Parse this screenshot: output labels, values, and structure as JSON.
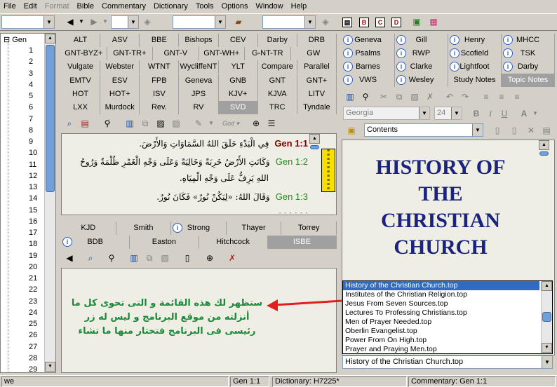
{
  "menu": [
    "File",
    "Edit",
    "Format",
    "Bible",
    "Commentary",
    "Dictionary",
    "Tools",
    "Options",
    "Window",
    "Help"
  ],
  "tree": {
    "root": "Gen",
    "chapters": [
      "1",
      "2",
      "3",
      "4",
      "5",
      "6",
      "7",
      "8",
      "9",
      "10",
      "11",
      "12",
      "13",
      "14",
      "15",
      "16",
      "17",
      "18",
      "19",
      "20",
      "21",
      "22",
      "23",
      "24",
      "25",
      "26",
      "27",
      "28",
      "29"
    ]
  },
  "bible_tabs": [
    [
      "ALT",
      "ASV",
      "BBE",
      "Bishops",
      "CEV",
      "Darby",
      "DRB"
    ],
    [
      "GNT-BYZ+",
      "GNT-TR+",
      "GNT-V",
      "GNT-WH+",
      "G-NT-TR (Steph)+",
      "GW"
    ],
    [
      "Vulgate",
      "Webster",
      "WTNT",
      "WycliffeNT",
      "YLT",
      "Compare",
      "Parallel"
    ],
    [
      "EMTV",
      "ESV",
      "FPB",
      "Geneva",
      "GNB",
      "GNT",
      "GNT+"
    ],
    [
      "HOT",
      "HOT+",
      "ISV",
      "JPS",
      "KJV+",
      "KJVA",
      "LITV"
    ],
    [
      "LXX",
      "Murdock",
      "Rev. Webster+",
      "RV",
      "SVD",
      "TRC",
      "Tyndale"
    ]
  ],
  "bible_active": "SVD",
  "bible_verses": [
    {
      "ref": "Gen 1:1",
      "text": "فِي الْبَدْءِ خَلَقَ اللهُ السَّمَاوَاتِ وَالأَرْضَ."
    },
    {
      "ref": "Gen 1:2",
      "text": "وَكَانَتِ الأَرْضُ خَرِبَةً وَخَالِيَةً وَعَلَى وَجْهِ الْغَمْرِ ظُلْمَةٌ وَرُوحُ"
    },
    {
      "ref": "",
      "text": "اللهِ يَرِفُّ عَلَى وَجْهِ الْمِيَاهِ."
    },
    {
      "ref": "Gen 1:3",
      "text": "وَقَالَ اللهُ: «لِيَكُنْ نُورٌ» فَكَانَ نُورٌ."
    }
  ],
  "dict_tabs": [
    [
      "KJD",
      "Smith",
      "Strong",
      "Thayer",
      "Torrey"
    ],
    [
      "BDB",
      "Easton",
      "Hitchcock",
      "ISBE"
    ]
  ],
  "dict_active": "ISBE",
  "annotation": [
    "ستظهر لك هذه القائمة و التى تحوى كل ما",
    "أنزلته من موقع البرنامج و ليس له زر",
    "رئيسى فى البرنامج فتختار منها ما تشاء"
  ],
  "comm_tabs": [
    [
      "Geneva",
      "Gill",
      "Henry",
      "MHCC"
    ],
    [
      "Psalms",
      "RWP",
      "Scofield",
      "TSK"
    ],
    [
      "Barnes",
      "Clarke",
      "Lightfoot",
      "Darby"
    ],
    [
      "VWS",
      "Wesley",
      "Study Notes",
      "Topic Notes"
    ]
  ],
  "comm_active": "Topic Notes",
  "format": {
    "font": "Georgia",
    "size": "24",
    "contents": "Contents"
  },
  "doc_title": [
    "HISTORY OF",
    "THE",
    "CHRISTIAN",
    "CHURCH"
  ],
  "topics": [
    "History of the Christian Church.top",
    "Institutes of the Christian Religion.top",
    "Jesus From Seven Sources.top",
    "Lectures To Professing Christians.top",
    "Men of Prayer Needed.top",
    "Oberlin Evangelist.top",
    "Power From On High.top",
    "Prayer and Praying Men.top"
  ],
  "topic_selected": "History of the Christian Church.top",
  "status": {
    "left": "we",
    "verse": "Gen 1:1",
    "dictionary": "Dictionary: H7225*",
    "commentary": "Commentary: Gen 1:1"
  },
  "colors": {
    "title": "#1a237e",
    "arabic": "#1a8a3a",
    "arrow": "#e02020",
    "selection": "#316ac5"
  }
}
